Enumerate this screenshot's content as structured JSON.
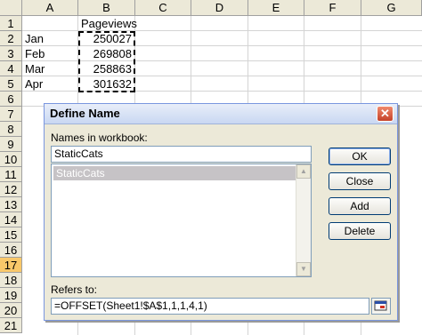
{
  "columns": [
    "A",
    "B",
    "C",
    "D",
    "E",
    "F",
    "G"
  ],
  "rows": [
    "1",
    "2",
    "3",
    "4",
    "5",
    "6",
    "7",
    "8",
    "9",
    "10",
    "11",
    "12",
    "13",
    "14",
    "15",
    "16",
    "17",
    "18",
    "19",
    "20",
    "21"
  ],
  "active_row": "17",
  "cells": {
    "b1": "Pageviews",
    "a2": "Jan",
    "b2": "250027",
    "a3": "Feb",
    "b3": "269808",
    "a4": "Mar",
    "b4": "258863",
    "a5": "Apr",
    "b5": "301632"
  },
  "dialog": {
    "title": "Define Name",
    "close_glyph": "✕",
    "names_label": "Names in workbook:",
    "name_value": "StaticCats",
    "list_items": [
      "StaticCats"
    ],
    "buttons": {
      "ok": "OK",
      "close": "Close",
      "add": "Add",
      "delete": "Delete"
    },
    "refers_label": "Refers to:",
    "refers_value": "=OFFSET(Sheet1!$A$1,1,1,4,1)"
  },
  "colors": {
    "header_bg": "#ece9d8",
    "active_row": "#f9c86a",
    "selection": "#c6c3c6"
  },
  "icons": {
    "scroll_up": "scroll-up-icon",
    "scroll_down": "scroll-down-icon",
    "collapse": "collapse-dialog-icon"
  }
}
